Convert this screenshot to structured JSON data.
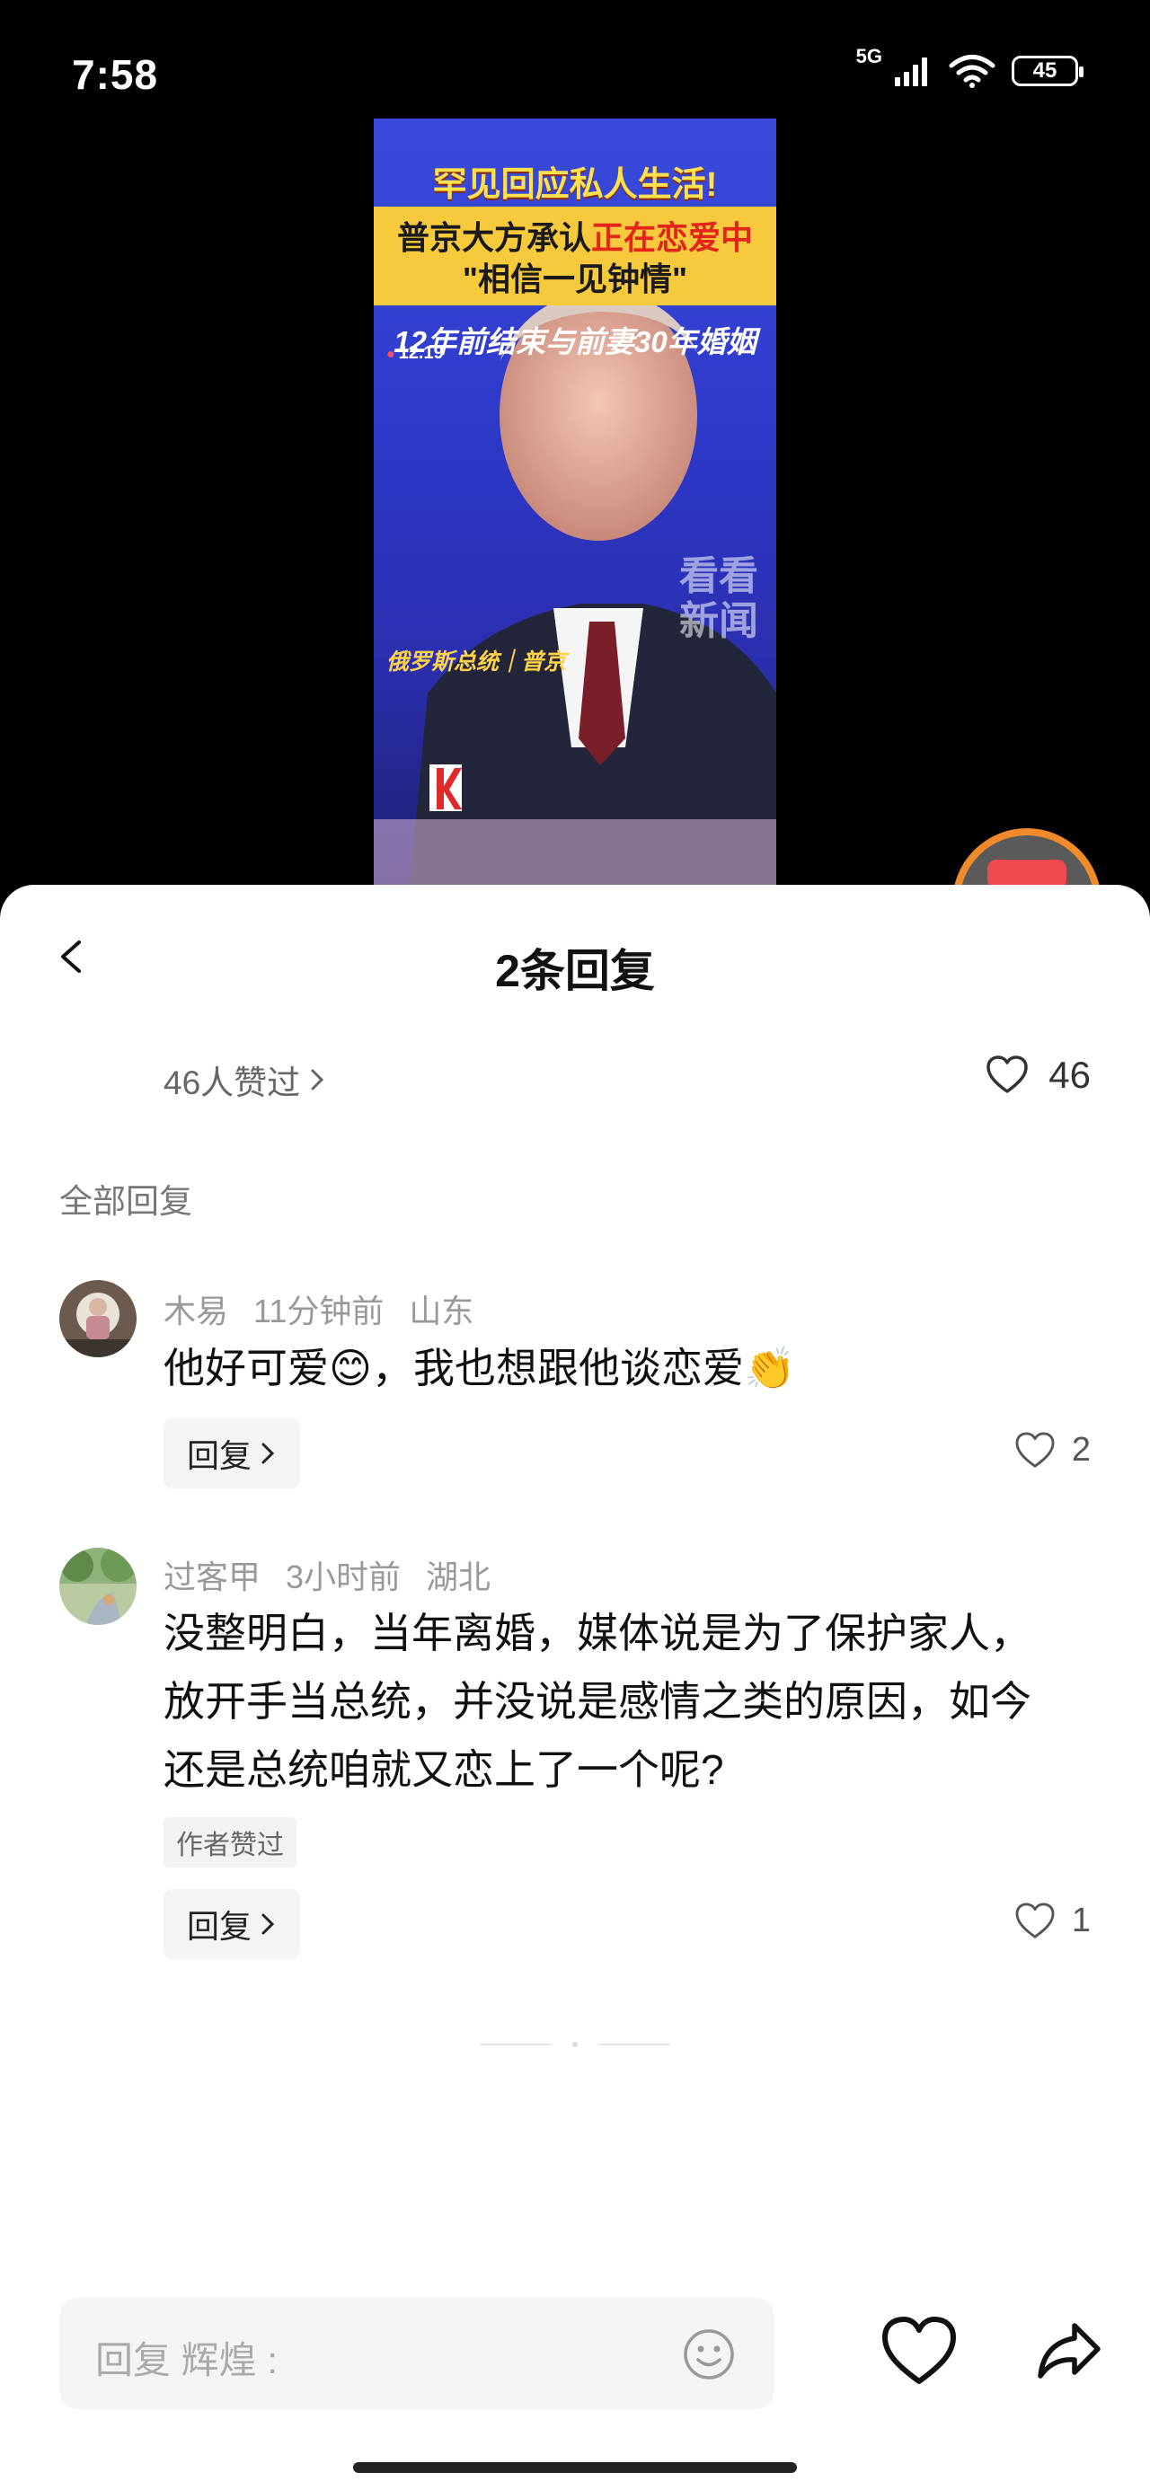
{
  "status_bar": {
    "time": "7:58",
    "network": "5G",
    "battery": "45"
  },
  "video": {
    "headline": "罕见回应私人生活!",
    "band_line1_a": "普京大方承认",
    "band_line1_b": "正在恋爱中",
    "band_line2": "\"相信一见钟情\"",
    "subhead": "12年前结束与前妻30年婚姻",
    "date": "12.19",
    "watermark_1": "看看",
    "watermark_2": "新闻",
    "name_caption": "俄罗斯总统｜普京"
  },
  "sheet": {
    "title": "2条回复",
    "likers_text": "46人赞过",
    "like_count": "46",
    "section_label": "全部回复"
  },
  "comments": [
    {
      "author": "木易",
      "time": "11分钟前",
      "location": "山东",
      "text": "他好可爱😊，我也想跟他谈恋爱👏",
      "reply_label": "回复",
      "likes": "2"
    },
    {
      "author": "过客甲",
      "time": "3小时前",
      "location": "湖北",
      "text": "没整明白，当年离婚，媒体说是为了保护家人，放开手当总统，并没说是感情之类的原因，如今还是总统咱就又恋上了一个呢?",
      "badge": "作者赞过",
      "reply_label": "回复",
      "likes": "1"
    }
  ],
  "input": {
    "placeholder": "回复 辉煌 :"
  },
  "colors": {
    "accent_orange": "#f08a2a",
    "red_packet": "#e42b32"
  },
  "icons": [
    "back-icon",
    "heart-icon",
    "chevron-right-icon",
    "emoji-icon",
    "share-icon",
    "red-packet-icon"
  ]
}
